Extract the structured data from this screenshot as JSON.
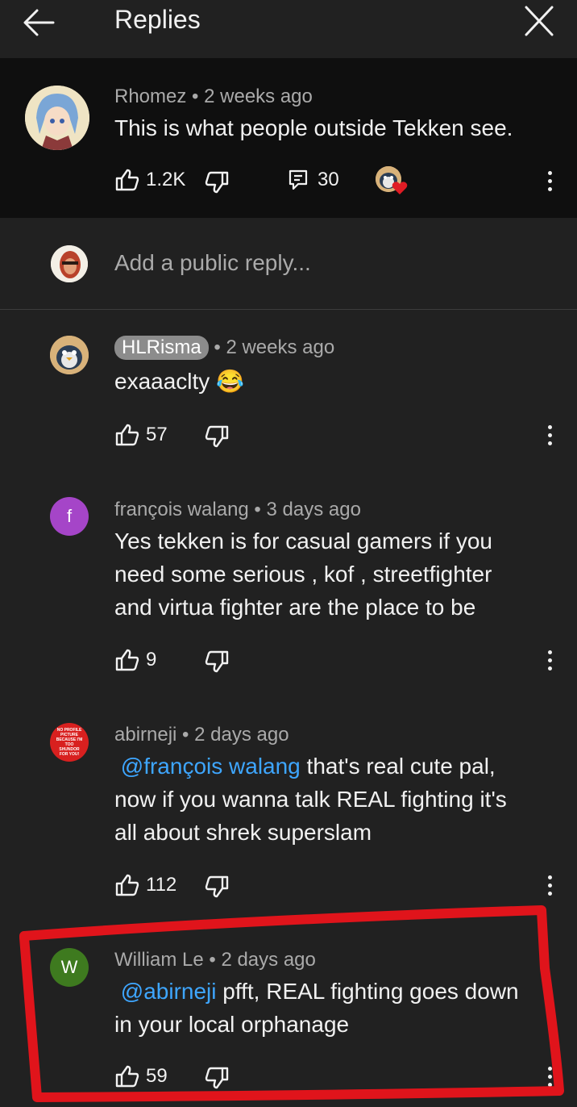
{
  "header": {
    "title": "Replies"
  },
  "parent": {
    "author": "Rhomez",
    "age": "2 weeks ago",
    "text": "This is what people outside Tekken see.",
    "likes": "1.2K",
    "replies": "30"
  },
  "reply_box": {
    "placeholder": "Add a public reply..."
  },
  "comments": [
    {
      "author": "HLRisma",
      "age": "2 weeks ago",
      "text": "exaaaclty",
      "emoji": "😂",
      "likes": "57"
    },
    {
      "author": "françois walang",
      "age": "3 days ago",
      "avatar_letter": "f",
      "lines": [
        "Yes tekken is for casual  gamers  if you",
        "need some serious ,  kof , streetfighter",
        "and virtua fighter are the place to be"
      ],
      "likes": "9"
    },
    {
      "author": "abirneji",
      "age": "2 days ago",
      "avatar_text": "NO PROFILE PICTURE BECAUSE I'M TOO SHUNDOR FOR YOU!",
      "mention": "@françois walang",
      "line1_rest": "  that's real cute pal,",
      "lines": [
        "now if you wanna talk REAL fighting it's",
        "all about shrek superslam"
      ],
      "likes": "112"
    },
    {
      "author": "William Le",
      "age": "2 days ago",
      "avatar_letter": "W",
      "mention": "@abirneji",
      "line1_rest": "  pfft, REAL fighting goes down",
      "lines": [
        "in your local orphanage"
      ],
      "likes": "59"
    }
  ],
  "colors": {
    "mention": "#3ea6ff",
    "highlight": "#e0141b",
    "avatar_f": "#a545c8",
    "avatar_w": "#3e7a1f"
  }
}
